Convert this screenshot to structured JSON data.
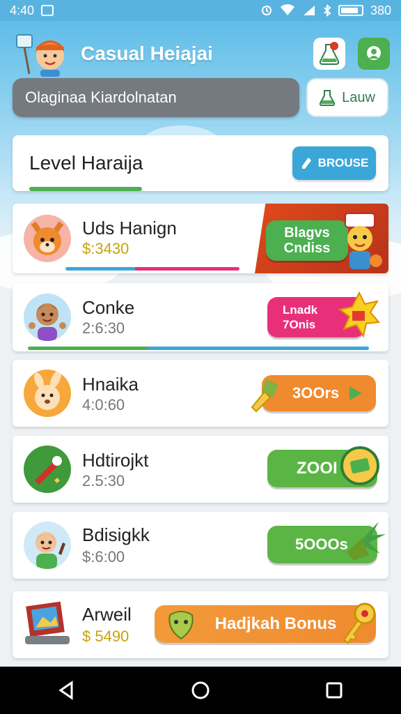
{
  "status": {
    "time": "4:40",
    "battery": "380"
  },
  "app": {
    "title": "Casual Heiajai"
  },
  "search": {
    "value": "Olaginaa Kiardolnatan"
  },
  "login": {
    "label": "Lauw"
  },
  "level": {
    "title": "Level Haraija",
    "browse_label": "BROUSE",
    "progress": 0.33
  },
  "items": [
    {
      "name": "Uds Hanign",
      "sub": "$:3430",
      "cta_line1": "Blagvs",
      "cta_line2": "Cndiss"
    },
    {
      "name": "Conke",
      "sub": "2:6:30",
      "cta_line1": "Lnadk",
      "cta_line2": "7Onis"
    },
    {
      "name": "Hnaika",
      "sub": "4:0:60",
      "cta": "3OOrs"
    },
    {
      "name": "Hdtirojkt",
      "sub": "2.5:30",
      "cta": "ZOOI"
    },
    {
      "name": "Bdisigkk",
      "sub": "$:6:00",
      "cta": "5OOOs"
    },
    {
      "name": "Arweil",
      "sub": "$ 5490",
      "cta": "Hadjkah Bonus"
    }
  ],
  "colors": {
    "header": "#5fbde8",
    "green": "#4caf50",
    "orange": "#f08a2e",
    "pink": "#e8307a",
    "blue": "#3aa7d8"
  }
}
